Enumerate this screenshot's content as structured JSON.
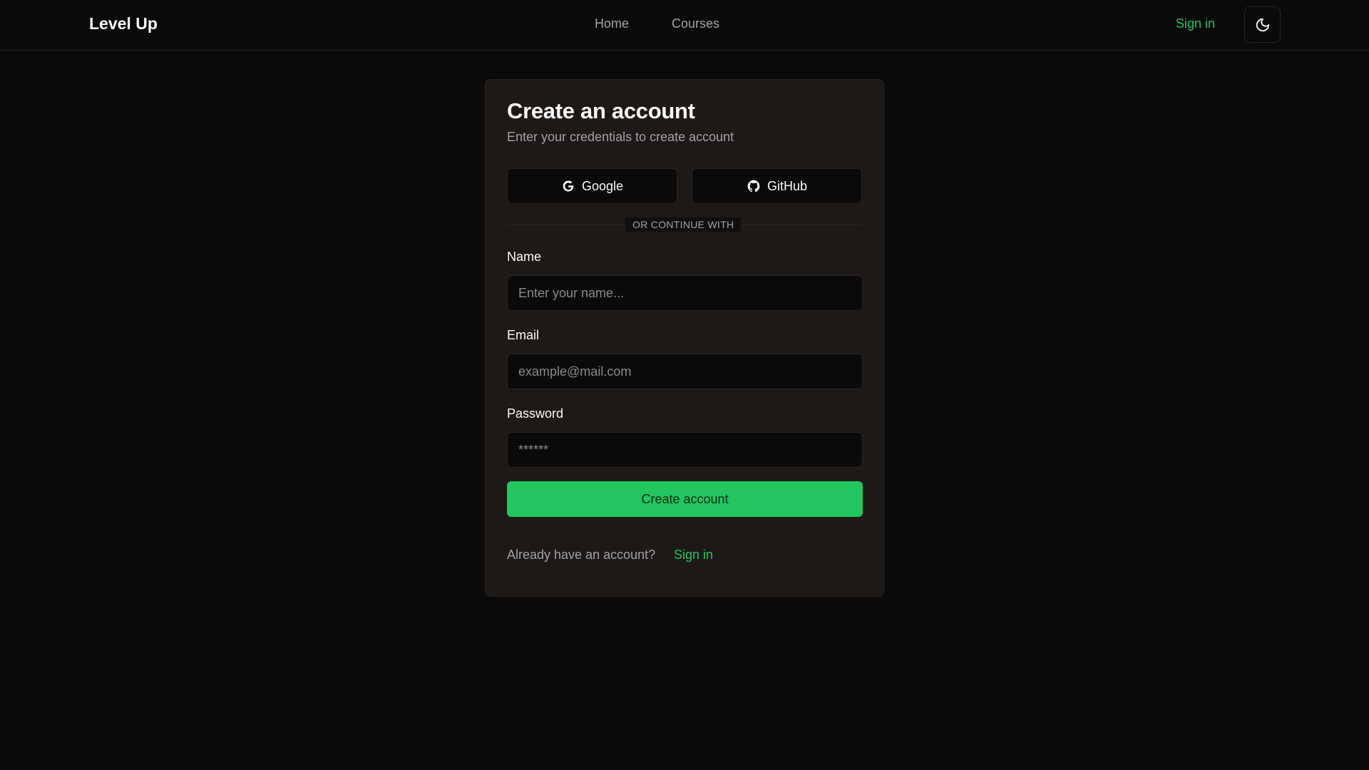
{
  "header": {
    "brand": "Level Up",
    "nav": [
      {
        "label": "Home"
      },
      {
        "label": "Courses"
      }
    ],
    "signin_label": "Sign in",
    "theme_icon": "moon-icon"
  },
  "card": {
    "title": "Create an account",
    "subtitle": "Enter your credentials to create account",
    "oauth": {
      "google_label": "Google",
      "google_icon": "google-icon",
      "github_label": "GitHub",
      "github_icon": "github-icon"
    },
    "divider": "OR CONTINUE WITH",
    "fields": {
      "name": {
        "label": "Name",
        "placeholder": "Enter your name..."
      },
      "email": {
        "label": "Email",
        "placeholder": "example@mail.com"
      },
      "password": {
        "label": "Password",
        "placeholder": "******"
      }
    },
    "submit_label": "Create account",
    "footer_text": "Already have an account?",
    "footer_link": "Sign in"
  },
  "colors": {
    "background": "#0a0a0a",
    "card": "#1c1917",
    "accent": "#22c55e",
    "muted_text": "#a1a1aa",
    "border": "#292524"
  }
}
